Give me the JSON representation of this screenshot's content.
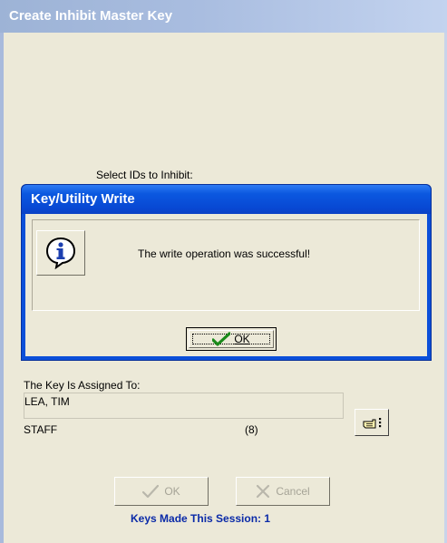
{
  "window": {
    "title": "Create Inhibit Master Key"
  },
  "select_label": "Select IDs to Inhibit:",
  "dialog": {
    "title": "Key/Utility Write",
    "message": "The write operation was successful!",
    "ok_label": "OK",
    "icon": "information-icon"
  },
  "assignment": {
    "label": "The Key Is Assigned To:",
    "name": "LEA, TIM",
    "role": "STAFF",
    "count": "(8)",
    "button_icon": "pointing-hand-icon"
  },
  "buttons": {
    "ok_label": "OK",
    "cancel_label": "Cancel"
  },
  "session": {
    "text": "Keys Made This Session: 1"
  },
  "colors": {
    "dialog_title": "#0b4fd9",
    "session_text": "#0a2aa8",
    "disabled_text": "#a6a497"
  }
}
